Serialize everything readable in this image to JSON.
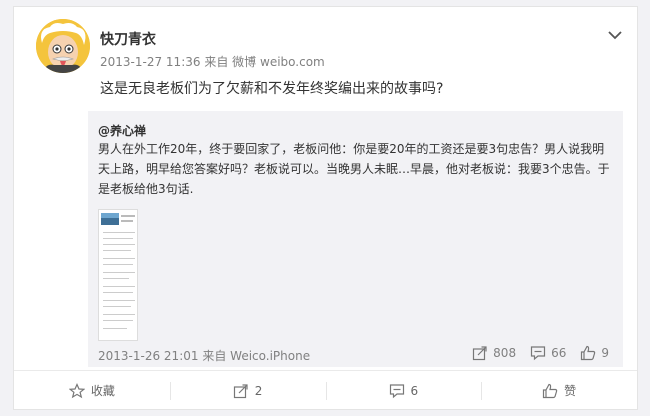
{
  "post": {
    "username": "快刀青衣",
    "timestamp": "2013-1-27 11:36",
    "source_prefix": "来自",
    "source_name": "微博",
    "source_url": "weibo.com",
    "text": "这是无良老板们为了欠薪和不发年终奖编出来的故事吗?"
  },
  "repost": {
    "original_user": "@养心禅",
    "text": "男人在外工作20年，终于要回家了，老板问他：你是要20年的工资还是要3句忠告？男人说我明天上路，明早给您答案好吗？老板说可以。当晚男人未眠…早晨，他对老板说：我要3个忠告。于是老板给他3句话.",
    "timestamp": "2013-1-26 21:01",
    "source_prefix": "来自",
    "source_name": "Weico.iPhone",
    "repost_count": "808",
    "comment_count": "66",
    "like_count": "9"
  },
  "actions": {
    "favorite_label": "收藏",
    "repost_count": "2",
    "comment_count": "6",
    "like_label": "赞"
  },
  "icons": {
    "avatar": "einstein-avatar",
    "menu": "chevron-down-icon",
    "favorite": "star-icon",
    "repost": "share-icon",
    "comment": "comment-icon",
    "like": "thumbs-up-icon"
  },
  "colors": {
    "page_background": "#f2f2f5",
    "card_background": "#ffffff",
    "repost_background": "#f2f2f5",
    "primary_text": "#333333",
    "secondary_text": "#808080"
  }
}
